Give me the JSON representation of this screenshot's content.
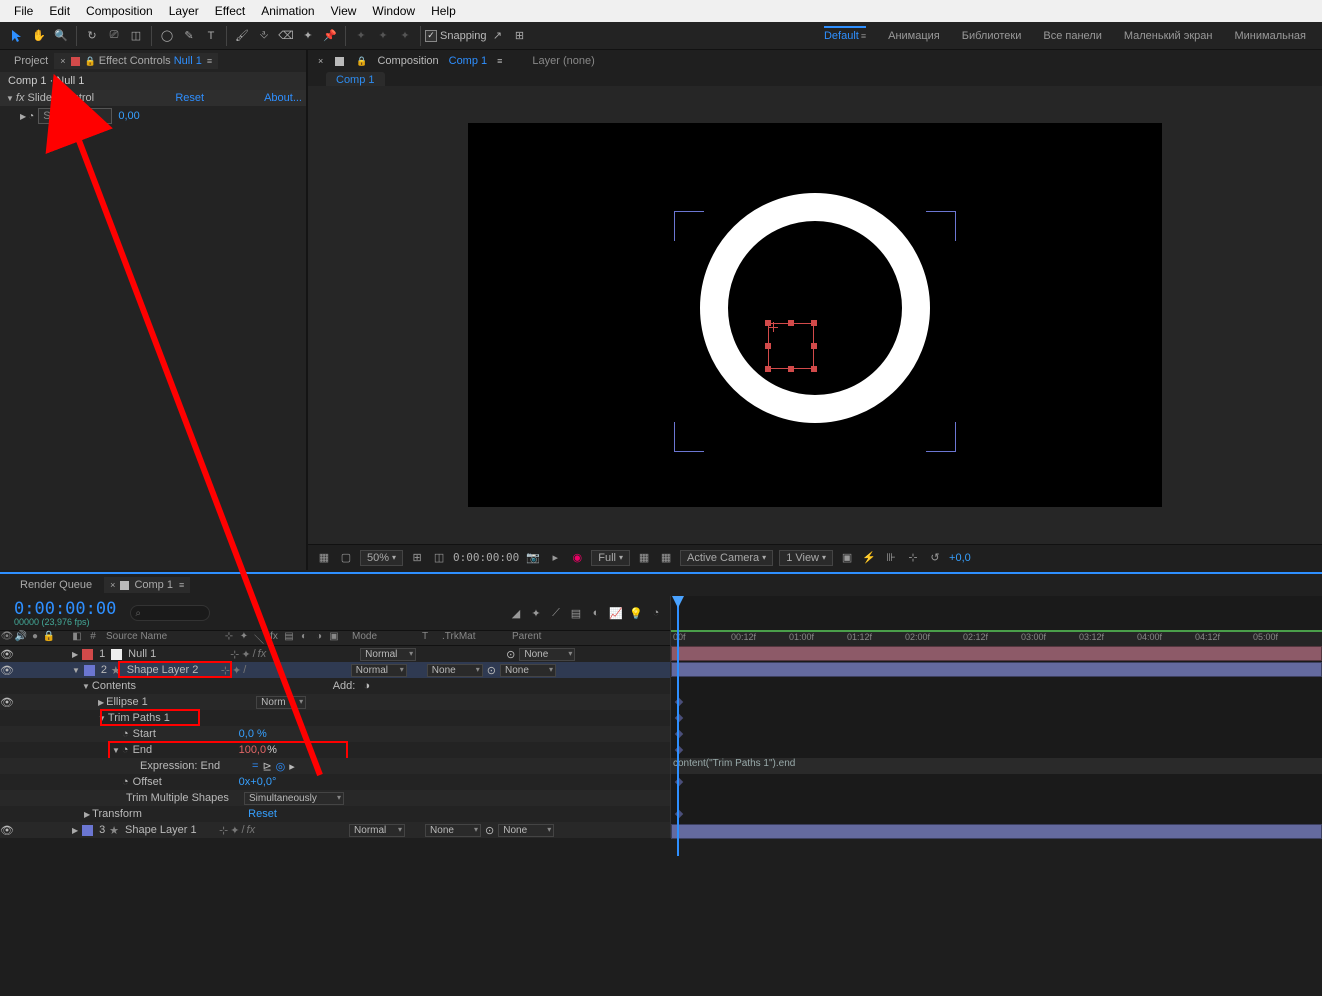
{
  "menu": {
    "file": "File",
    "edit": "Edit",
    "comp": "Composition",
    "layer": "Layer",
    "effect": "Effect",
    "anim": "Animation",
    "view": "View",
    "window": "Window",
    "help": "Help"
  },
  "toolbar": {
    "snapping": "Snapping"
  },
  "workspaces": {
    "default": "Default",
    "anim": "Анимация",
    "lib": "Библиотеки",
    "all": "Все панели",
    "small": "Маленький экран",
    "min": "Минимальная"
  },
  "left": {
    "tab_project": "Project",
    "tab_effect_controls": "Effect Controls",
    "ec_target": "Null 1",
    "breadcrumb": "Comp 1 · Null 1",
    "fx_name": "Slider Control",
    "reset": "Reset",
    "about": "About...",
    "slider_label": "Slider",
    "slider_val": "0,00"
  },
  "comp": {
    "tab_composition": "Composition",
    "tab_target": "Comp 1",
    "layer_none": "Layer (none)",
    "subtab": "Comp 1"
  },
  "viewer": {
    "zoom": "50%",
    "time": "0:00:00:00",
    "quality": "Full",
    "camera": "Active Camera",
    "views": "1 View",
    "exposure": "+0,0"
  },
  "timeline": {
    "tabs": {
      "rq": "Render Queue",
      "comp": "Comp 1"
    },
    "timecode": "0:00:00:00",
    "timesub": "00000 (23,976 fps)",
    "cols": {
      "num": "#",
      "source": "Source Name",
      "mode": "Mode",
      "t": "T",
      "trkmat": ".TrkMat",
      "parent": "Parent"
    },
    "layers": {
      "null": {
        "num": "1",
        "name": "Null 1",
        "mode": "Normal",
        "parent": "None"
      },
      "shape2": {
        "num": "2",
        "name": "Shape Layer 2",
        "mode": "Normal",
        "trkmat": "None",
        "parent": "None"
      },
      "contents": "Contents",
      "add": "Add:",
      "ellipse": "Ellipse 1",
      "emode": "Norm",
      "trim": "Trim Paths 1",
      "start": "Start",
      "start_val": "0,0 %",
      "end": "End",
      "end_val": "100,0",
      "end_unit": "%",
      "expr_end": "Expression: End",
      "offset": "Offset",
      "offset_val": "0x+0,0°",
      "tms": "Trim Multiple Shapes",
      "tms_val": "Simultaneously",
      "transform": "Transform",
      "reset": "Reset",
      "shape1": {
        "num": "3",
        "name": "Shape Layer 1",
        "mode": "Normal",
        "trkmat": "None",
        "parent": "None"
      }
    },
    "ruler": [
      "00f",
      "00:12f",
      "01:00f",
      "01:12f",
      "02:00f",
      "02:12f",
      "03:00f",
      "03:12f",
      "04:00f",
      "04:12f",
      "05:00f"
    ],
    "expr_text": "content(\"Trim Paths 1\").end"
  }
}
